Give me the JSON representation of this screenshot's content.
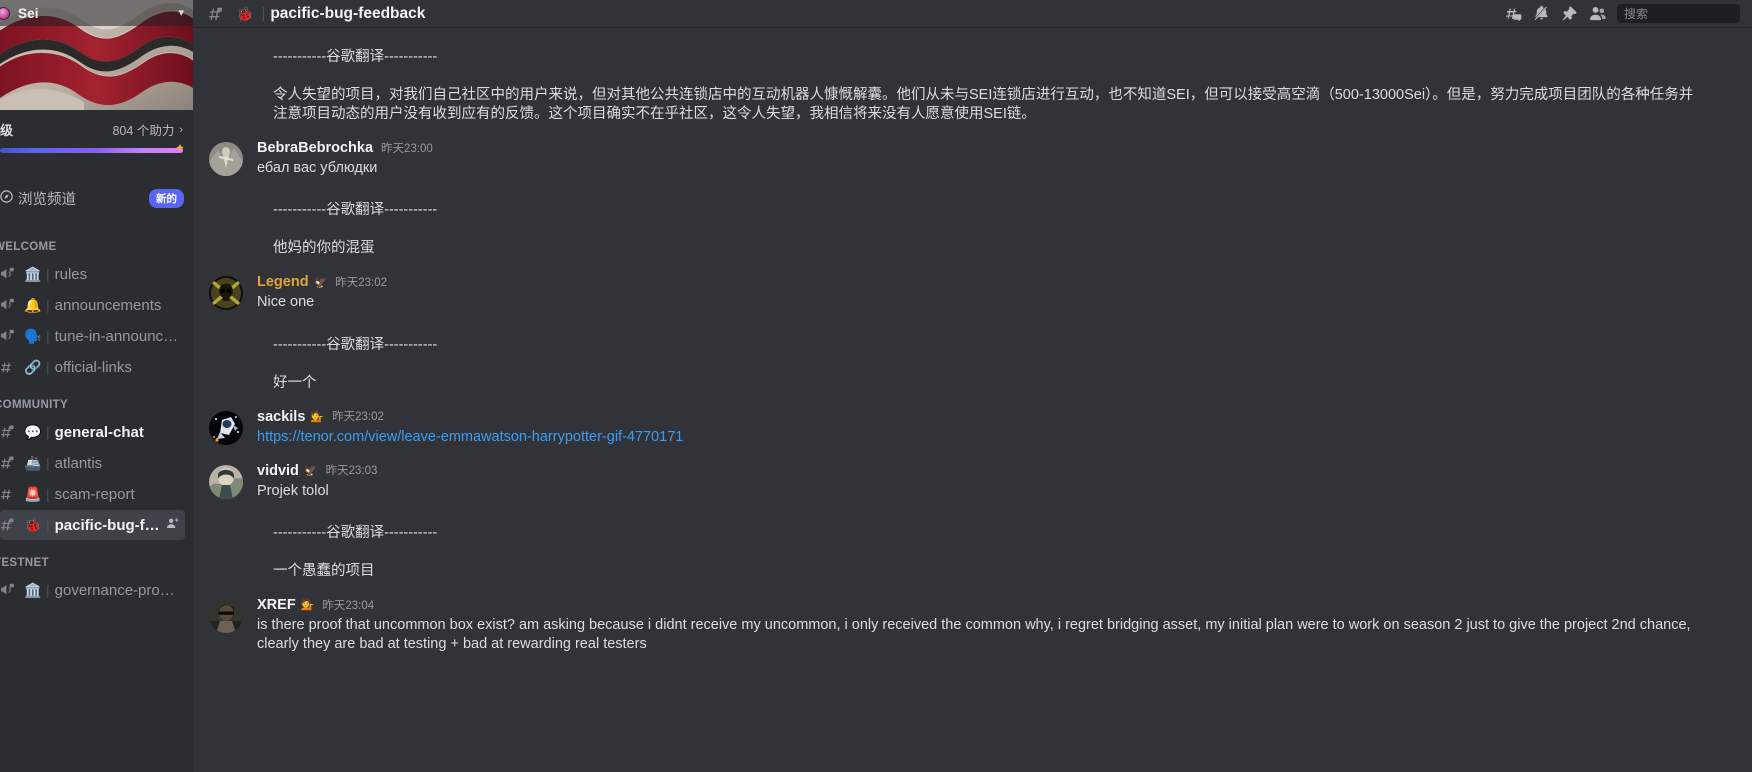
{
  "server": {
    "name": "Sei",
    "chevron_icon": "chevron-down-icon",
    "boost_level_label": "级",
    "boost_count_label": "804 个助力",
    "boost_arrow_icon": "chevron-right-icon",
    "browse_channels_label": "浏览频道",
    "browse_channels_badge": "新的",
    "browse_icon": "compass-icon"
  },
  "sidebar": {
    "categories": [
      {
        "label": "WELCOME",
        "channels": [
          {
            "name": "rules",
            "icon": "announcement-channel-icon",
            "emoji": "🏛️",
            "active": false,
            "unread": false
          },
          {
            "name": "announcements",
            "icon": "announcement-channel-icon",
            "emoji": "🔔",
            "active": false,
            "unread": false
          },
          {
            "name": "tune-in-announcem…",
            "icon": "announcement-channel-icon",
            "emoji": "🗣️",
            "active": false,
            "unread": false
          },
          {
            "name": "official-links",
            "icon": "hash-icon",
            "emoji": "🔗",
            "active": false,
            "unread": false
          }
        ]
      },
      {
        "label": "COMMUNITY",
        "channels": [
          {
            "name": "general-chat",
            "icon": "hash-lock-icon",
            "emoji": "💬",
            "active": false,
            "unread": true
          },
          {
            "name": "atlantis",
            "icon": "hash-lock-icon",
            "emoji": "🚢",
            "active": false,
            "unread": false
          },
          {
            "name": "scam-report",
            "icon": "hash-icon",
            "emoji": "🚨",
            "active": false,
            "unread": false
          },
          {
            "name": "pacific-bug-feed…",
            "icon": "hash-lock-icon",
            "emoji": "🐞",
            "active": true,
            "unread": true,
            "action_icon": "add-member-icon"
          }
        ]
      },
      {
        "label": "TESTNET",
        "channels": [
          {
            "name": "governance-proposals",
            "icon": "announcement-channel-icon",
            "emoji": "🏛️",
            "active": false,
            "unread": false
          }
        ]
      }
    ]
  },
  "header": {
    "channel_icon": "hash-lock-icon",
    "channel_emoji": "🐞",
    "channel_name": "pacific-bug-feedback",
    "actions": [
      {
        "name": "threads-icon"
      },
      {
        "name": "notifications-off-icon"
      },
      {
        "name": "pinned-messages-icon"
      },
      {
        "name": "member-list-icon"
      }
    ]
  },
  "search": {
    "placeholder": "搜索",
    "value": "",
    "icon": "search-icon"
  },
  "messages": [
    {
      "type": "separator",
      "text": "-----------谷歌翻译-----------"
    },
    {
      "type": "continuation",
      "text": "令人失望的项目，对我们自己社区中的用户来说，但对其他公共连锁店中的互动机器人慷慨解囊。他们从未与SEI连锁店进行互动，也不知道SEI，但可以接受高空滴（500-13000Sei）。但是，努力完成项目团队的各种任务并注意项目动态的用户没有收到应有的反馈。这个项目确实不在乎社区，这令人失望，我相信将来没有人愿意使用SEI链。"
    },
    {
      "type": "message",
      "username": "BebraBebrochka",
      "username_color": "default",
      "timestamp": "昨天23:00",
      "avatar": "stone-statue-avatar",
      "text": "ебал вас ублюдки"
    },
    {
      "type": "separator",
      "text": "-----------谷歌翻译-----------"
    },
    {
      "type": "continuation",
      "text": "他妈的你的混蛋"
    },
    {
      "type": "message",
      "username": "Legend",
      "username_color": "gold",
      "badge": "🦅",
      "timestamp": "昨天23:02",
      "avatar": "skull-crossbones-avatar",
      "text": "Nice one"
    },
    {
      "type": "separator",
      "text": "-----------谷歌翻译-----------"
    },
    {
      "type": "continuation",
      "text": "好一个"
    },
    {
      "type": "message",
      "username": "sackils",
      "username_color": "default",
      "badge": "💁",
      "timestamp": "昨天23:02",
      "avatar": "astronaut-avatar",
      "link": "https://tenor.com/view/leave-emmawatson-harrypotter-gif-4770171"
    },
    {
      "type": "message",
      "username": "vidvid",
      "username_color": "default",
      "badge": "🦅",
      "timestamp": "昨天23:03",
      "avatar": "anime-avatar",
      "text": "Projek tolol"
    },
    {
      "type": "separator",
      "text": "-----------谷歌翻译-----------"
    },
    {
      "type": "continuation",
      "text": "一个愚蠢的项目"
    },
    {
      "type": "message",
      "username": "XREF",
      "username_color": "default",
      "badge": "💁",
      "timestamp": "昨天23:04",
      "avatar": "person-dark-avatar",
      "text": "is there proof that uncommon box exist? am asking because i didnt receive my uncommon, i only received the common why, i regret bridging asset, my initial plan were to work on season 2 just to give the project 2nd chance, clearly they are bad at testing + bad at rewarding real testers"
    }
  ],
  "colors": {
    "sidebar_bg": "#2b2d31",
    "main_bg": "#313338",
    "accent": "#5865f2",
    "link": "#3b9ef4",
    "gold_name": "#e0a33e",
    "muted_text": "#949ba4"
  }
}
